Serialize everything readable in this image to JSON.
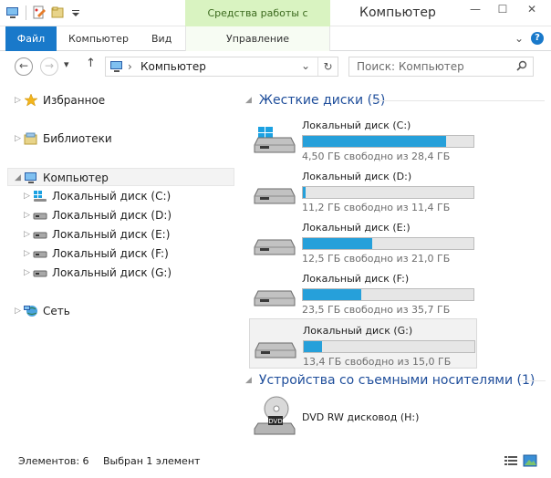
{
  "window": {
    "title": "Компьютер",
    "contextual_group": "Средства работы с дисками",
    "minimize": "—",
    "maximize": "☐",
    "close": "✕"
  },
  "ribbon": {
    "tabs": [
      "Файл",
      "Компьютер",
      "Вид"
    ],
    "contextual_tab": "Управление",
    "expand": "⌄",
    "help": "?"
  },
  "address_bar": {
    "back": "←",
    "forward": "→",
    "history": "▾",
    "up": "↑",
    "separator": "›",
    "location": "Компьютер",
    "dropdown": "⌄",
    "refresh": "↻",
    "search_placeholder": "Поиск: Компьютер"
  },
  "navigation_pane": {
    "favorites": "Избранное",
    "libraries": "Библиотеки",
    "computer": "Компьютер",
    "drives": [
      "Локальный диск (C:)",
      "Локальный диск (D:)",
      "Локальный диск (E:)",
      "Локальный диск (F:)",
      "Локальный диск (G:)"
    ],
    "network": "Сеть"
  },
  "content": {
    "hard_disks_header": "Жесткие диски (5)",
    "drives": [
      {
        "name": "Локальный диск (C:)",
        "free": "4,50 ГБ свободно из 28,4 ГБ",
        "used_fraction": 0.842
      },
      {
        "name": "Локальный диск (D:)",
        "free": "11,2 ГБ свободно из 11,4 ГБ",
        "used_fraction": 0.018
      },
      {
        "name": "Локальный диск (E:)",
        "free": "12,5 ГБ свободно из 21,0 ГБ",
        "used_fraction": 0.405
      },
      {
        "name": "Локальный диск (F:)",
        "free": "23,5 ГБ свободно из 35,7 ГБ",
        "used_fraction": 0.342
      },
      {
        "name": "Локальный диск (G:)",
        "free": "13,4 ГБ свободно из 15,0 ГБ",
        "used_fraction": 0.107
      }
    ],
    "removable_header": "Устройства со съемными носителями (1)",
    "dvd": {
      "name": "DVD RW дисковод (H:)",
      "icon_label": "DVD"
    }
  },
  "status_bar": {
    "items": "Элементов: 6",
    "selected": "Выбран 1 элемент"
  },
  "colors": {
    "accent": "#1979ca",
    "usage_bar": "#26a0da",
    "group_title": "#1f4e9b",
    "contextual": "#d9f3c1"
  }
}
